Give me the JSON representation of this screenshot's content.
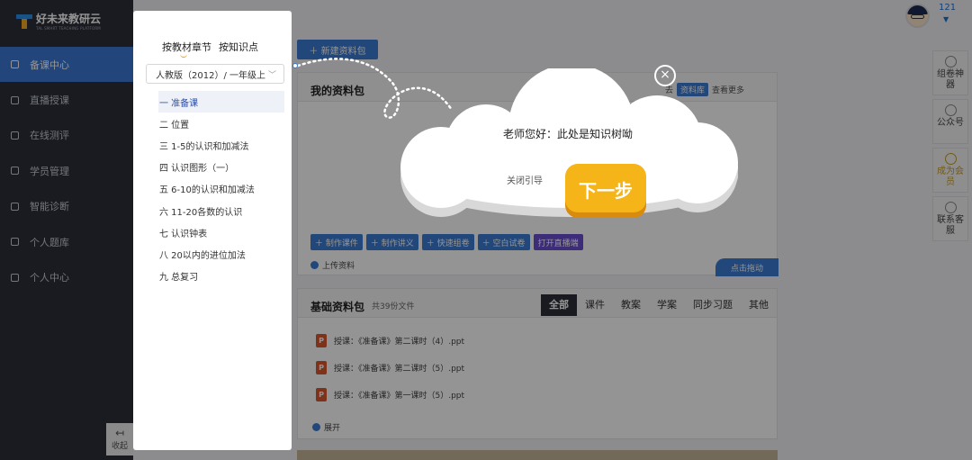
{
  "brand": {
    "name": "好未来教研云",
    "subtitle": "TAL SMART TEACHING PLATFORM"
  },
  "nav": [
    {
      "label": "备课中心",
      "active": true
    },
    {
      "label": "直播授课"
    },
    {
      "label": "在线测评"
    },
    {
      "label": "学员管理"
    },
    {
      "label": "智能诊断"
    },
    {
      "label": "个人题库"
    },
    {
      "label": "个人中心"
    }
  ],
  "collapse_label": "收起",
  "user": {
    "count": "121"
  },
  "right_panel": [
    {
      "label": "组卷神器"
    },
    {
      "label": "公众号"
    },
    {
      "label": "成为会员"
    },
    {
      "label": "联系客服"
    }
  ],
  "main": {
    "new_package": "新建资料包",
    "my_package": {
      "title": "我的资料包",
      "go": "去",
      "library": "资料库",
      "more": "查看更多",
      "tools": [
        "制作课件",
        "制作讲义",
        "快速组卷",
        "空白试卷",
        "打开直播端"
      ],
      "upload": "上传资料",
      "drag": "点击拖动"
    },
    "basic_package": {
      "title": "基础资料包",
      "count": "共39份文件",
      "tabs": [
        "全部",
        "课件",
        "教案",
        "学案",
        "同步习题",
        "其他"
      ],
      "files": [
        "授课：《准备课》第二课时（4）.ppt",
        "授课：《准备课》第二课时（5）.ppt",
        "授课：《准备课》第一课时（5）.ppt"
      ],
      "expand": "展开"
    }
  },
  "tree": {
    "tabs": [
      "按教材章节",
      "按知识点"
    ],
    "select_value": "人教版（2012）/ 一年级上",
    "chapters": [
      "一 准备课",
      "二 位置",
      "三 1-5的认识和加减法",
      "四 认识图形（一）",
      "五 6-10的认识和加减法",
      "六 11-20各数的认识",
      "七 认识钟表",
      "八 20以内的进位加法",
      "九 总复习"
    ]
  },
  "guide": {
    "message": "老师您好：此处是知识树呦",
    "close": "关闭引导",
    "next": "下一步",
    "close_icon": "×"
  }
}
